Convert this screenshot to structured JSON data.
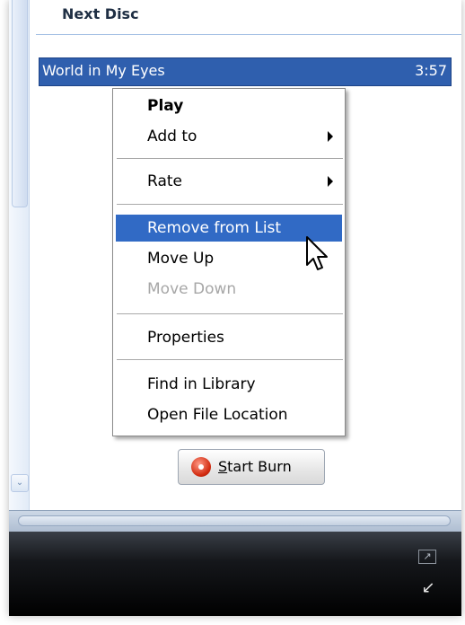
{
  "pane": {
    "title": "Next Disc"
  },
  "track": {
    "title": "World in My Eyes",
    "duration": "3:57"
  },
  "context_menu": {
    "items": [
      {
        "label": "Play",
        "bold": true,
        "enabled": true,
        "highlighted": false,
        "submenu": false
      },
      {
        "label": "Add to",
        "bold": false,
        "enabled": true,
        "highlighted": false,
        "submenu": true
      },
      {
        "label": "Rate",
        "bold": false,
        "enabled": true,
        "highlighted": false,
        "submenu": true
      },
      {
        "label": "Remove from List",
        "bold": false,
        "enabled": true,
        "highlighted": true,
        "submenu": false
      },
      {
        "label": "Move Up",
        "bold": false,
        "enabled": true,
        "highlighted": false,
        "submenu": false
      },
      {
        "label": "Move Down",
        "bold": false,
        "enabled": false,
        "highlighted": false,
        "submenu": false
      },
      {
        "label": "Properties",
        "bold": false,
        "enabled": true,
        "highlighted": false,
        "submenu": false
      },
      {
        "label": "Find in Library",
        "bold": false,
        "enabled": true,
        "highlighted": false,
        "submenu": false
      },
      {
        "label": "Open File Location",
        "bold": false,
        "enabled": true,
        "highlighted": false,
        "submenu": false
      }
    ]
  },
  "burn_button": {
    "accel": "S",
    "rest": "tart Burn",
    "icon": "burn-disc-icon"
  },
  "colors": {
    "selection": "#2f5fae",
    "menu_highlight": "#316ac5",
    "disabled_text": "#a7a7a7"
  },
  "icons": {
    "restore": "restore-window-icon",
    "minimize": "mini-player-icon",
    "cursor": "arrow-cursor-icon"
  }
}
